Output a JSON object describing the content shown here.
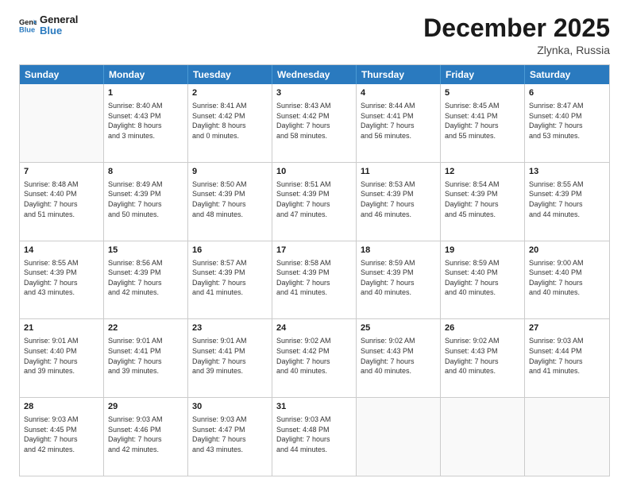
{
  "logo": {
    "line1": "General",
    "line2": "Blue"
  },
  "title": "December 2025",
  "location": "Zlynka, Russia",
  "header_days": [
    "Sunday",
    "Monday",
    "Tuesday",
    "Wednesday",
    "Thursday",
    "Friday",
    "Saturday"
  ],
  "rows": [
    [
      {
        "day": "",
        "info": ""
      },
      {
        "day": "1",
        "info": "Sunrise: 8:40 AM\nSunset: 4:43 PM\nDaylight: 8 hours\nand 3 minutes."
      },
      {
        "day": "2",
        "info": "Sunrise: 8:41 AM\nSunset: 4:42 PM\nDaylight: 8 hours\nand 0 minutes."
      },
      {
        "day": "3",
        "info": "Sunrise: 8:43 AM\nSunset: 4:42 PM\nDaylight: 7 hours\nand 58 minutes."
      },
      {
        "day": "4",
        "info": "Sunrise: 8:44 AM\nSunset: 4:41 PM\nDaylight: 7 hours\nand 56 minutes."
      },
      {
        "day": "5",
        "info": "Sunrise: 8:45 AM\nSunset: 4:41 PM\nDaylight: 7 hours\nand 55 minutes."
      },
      {
        "day": "6",
        "info": "Sunrise: 8:47 AM\nSunset: 4:40 PM\nDaylight: 7 hours\nand 53 minutes."
      }
    ],
    [
      {
        "day": "7",
        "info": "Sunrise: 8:48 AM\nSunset: 4:40 PM\nDaylight: 7 hours\nand 51 minutes."
      },
      {
        "day": "8",
        "info": "Sunrise: 8:49 AM\nSunset: 4:39 PM\nDaylight: 7 hours\nand 50 minutes."
      },
      {
        "day": "9",
        "info": "Sunrise: 8:50 AM\nSunset: 4:39 PM\nDaylight: 7 hours\nand 48 minutes."
      },
      {
        "day": "10",
        "info": "Sunrise: 8:51 AM\nSunset: 4:39 PM\nDaylight: 7 hours\nand 47 minutes."
      },
      {
        "day": "11",
        "info": "Sunrise: 8:53 AM\nSunset: 4:39 PM\nDaylight: 7 hours\nand 46 minutes."
      },
      {
        "day": "12",
        "info": "Sunrise: 8:54 AM\nSunset: 4:39 PM\nDaylight: 7 hours\nand 45 minutes."
      },
      {
        "day": "13",
        "info": "Sunrise: 8:55 AM\nSunset: 4:39 PM\nDaylight: 7 hours\nand 44 minutes."
      }
    ],
    [
      {
        "day": "14",
        "info": "Sunrise: 8:55 AM\nSunset: 4:39 PM\nDaylight: 7 hours\nand 43 minutes."
      },
      {
        "day": "15",
        "info": "Sunrise: 8:56 AM\nSunset: 4:39 PM\nDaylight: 7 hours\nand 42 minutes."
      },
      {
        "day": "16",
        "info": "Sunrise: 8:57 AM\nSunset: 4:39 PM\nDaylight: 7 hours\nand 41 minutes."
      },
      {
        "day": "17",
        "info": "Sunrise: 8:58 AM\nSunset: 4:39 PM\nDaylight: 7 hours\nand 41 minutes."
      },
      {
        "day": "18",
        "info": "Sunrise: 8:59 AM\nSunset: 4:39 PM\nDaylight: 7 hours\nand 40 minutes."
      },
      {
        "day": "19",
        "info": "Sunrise: 8:59 AM\nSunset: 4:40 PM\nDaylight: 7 hours\nand 40 minutes."
      },
      {
        "day": "20",
        "info": "Sunrise: 9:00 AM\nSunset: 4:40 PM\nDaylight: 7 hours\nand 40 minutes."
      }
    ],
    [
      {
        "day": "21",
        "info": "Sunrise: 9:01 AM\nSunset: 4:40 PM\nDaylight: 7 hours\nand 39 minutes."
      },
      {
        "day": "22",
        "info": "Sunrise: 9:01 AM\nSunset: 4:41 PM\nDaylight: 7 hours\nand 39 minutes."
      },
      {
        "day": "23",
        "info": "Sunrise: 9:01 AM\nSunset: 4:41 PM\nDaylight: 7 hours\nand 39 minutes."
      },
      {
        "day": "24",
        "info": "Sunrise: 9:02 AM\nSunset: 4:42 PM\nDaylight: 7 hours\nand 40 minutes."
      },
      {
        "day": "25",
        "info": "Sunrise: 9:02 AM\nSunset: 4:43 PM\nDaylight: 7 hours\nand 40 minutes."
      },
      {
        "day": "26",
        "info": "Sunrise: 9:02 AM\nSunset: 4:43 PM\nDaylight: 7 hours\nand 40 minutes."
      },
      {
        "day": "27",
        "info": "Sunrise: 9:03 AM\nSunset: 4:44 PM\nDaylight: 7 hours\nand 41 minutes."
      }
    ],
    [
      {
        "day": "28",
        "info": "Sunrise: 9:03 AM\nSunset: 4:45 PM\nDaylight: 7 hours\nand 42 minutes."
      },
      {
        "day": "29",
        "info": "Sunrise: 9:03 AM\nSunset: 4:46 PM\nDaylight: 7 hours\nand 42 minutes."
      },
      {
        "day": "30",
        "info": "Sunrise: 9:03 AM\nSunset: 4:47 PM\nDaylight: 7 hours\nand 43 minutes."
      },
      {
        "day": "31",
        "info": "Sunrise: 9:03 AM\nSunset: 4:48 PM\nDaylight: 7 hours\nand 44 minutes."
      },
      {
        "day": "",
        "info": ""
      },
      {
        "day": "",
        "info": ""
      },
      {
        "day": "",
        "info": ""
      }
    ]
  ]
}
